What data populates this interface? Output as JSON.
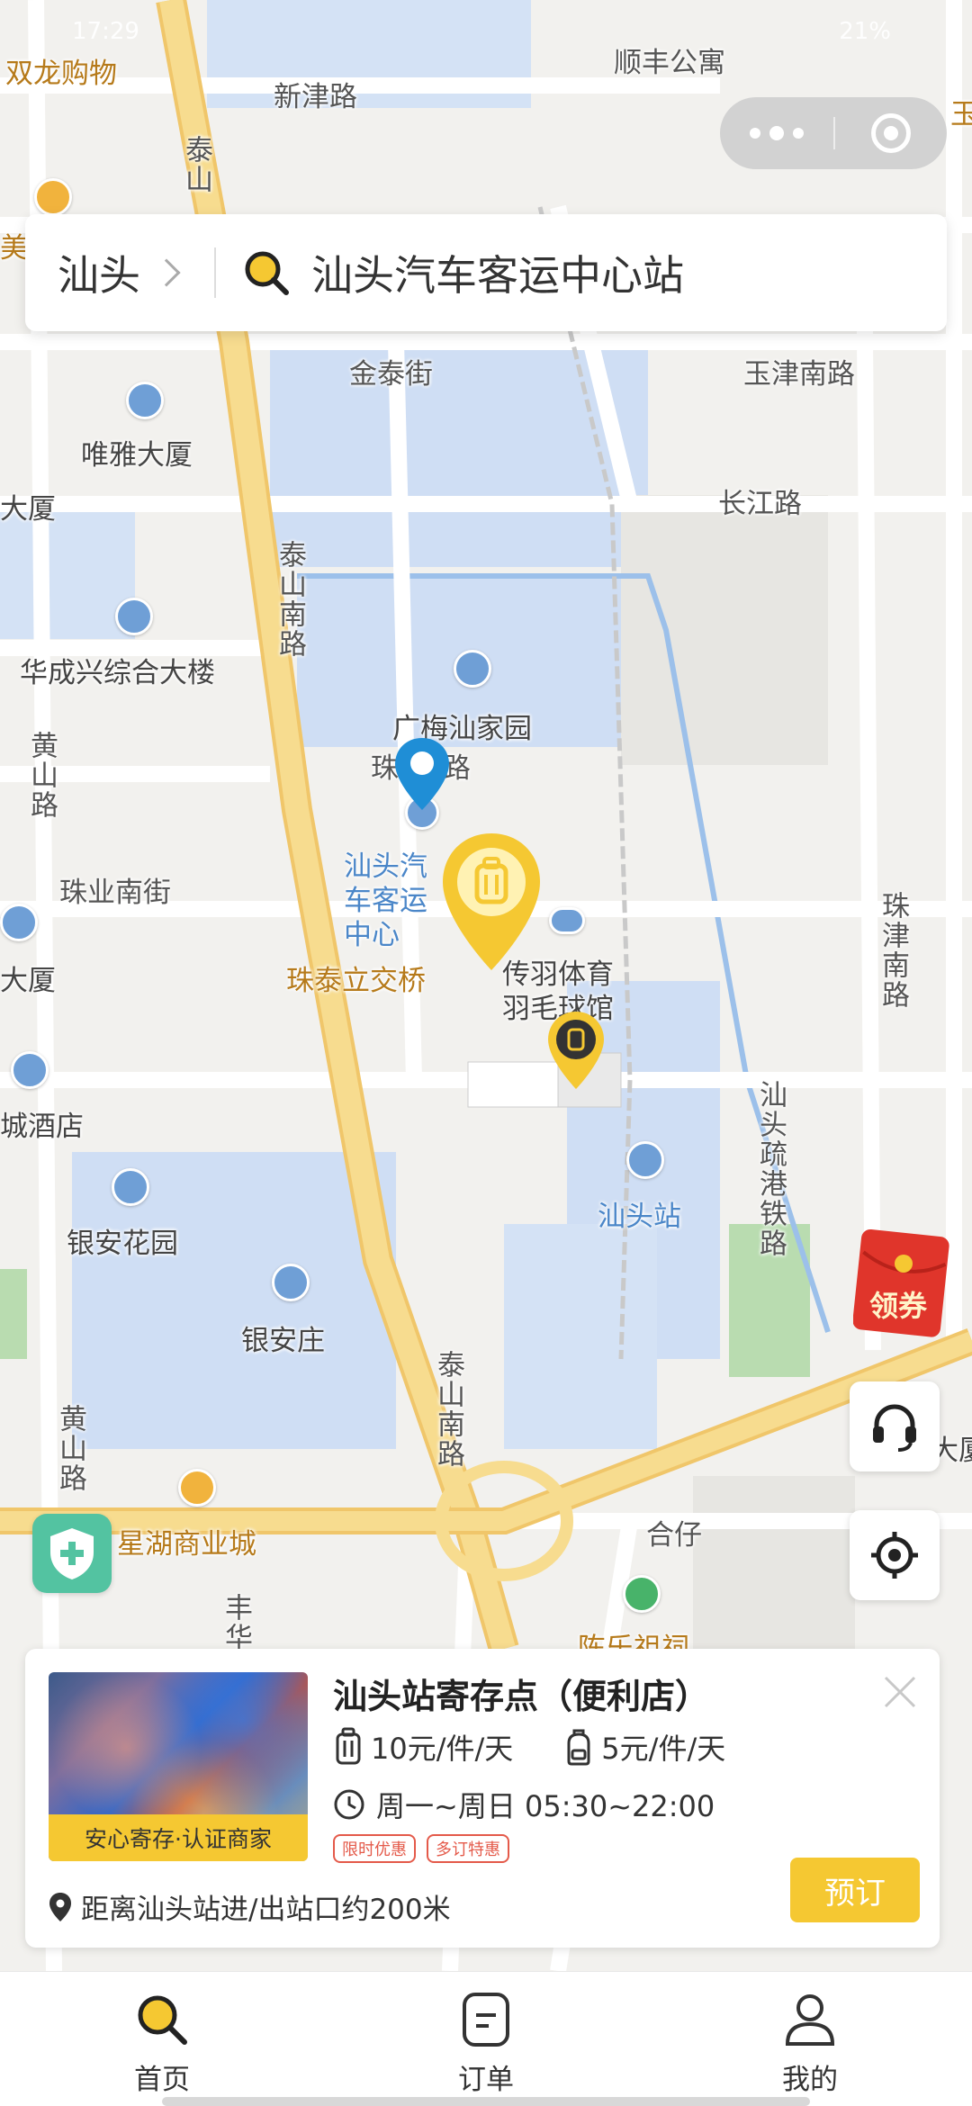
{
  "status_bar": {
    "time": "17:29",
    "battery": "21%"
  },
  "capsule": {
    "more_icon": "more-dots-icon",
    "close_icon": "close-ring-icon"
  },
  "search": {
    "city": "汕头",
    "station": "汕头汽车客运中心站"
  },
  "map_labels": {
    "shuanglong": "双龙购物",
    "shunfeng": "顺丰公寓",
    "xinjin": "新津路",
    "taishan_top": "泰山",
    "mei": "美",
    "yushan": "玉",
    "jintai": "金泰街",
    "yujin": "玉津南路",
    "weiya": "唯雅大厦",
    "dasha_left": "大厦",
    "changjiang": "长江路",
    "taishan_south": "泰山南路",
    "huachengxing": "华成兴综合大楼",
    "guangmei": "广梅汕家园",
    "huangshan1": "黄山路",
    "zhu_road": "珠",
    "zhu_road2": "路",
    "bus_station": "汕头汽车客运中心",
    "zhuye": "珠业南街",
    "dasha2": "大厦",
    "zhutai": "珠泰立交桥",
    "chuanyu": "传羽体育羽毛球馆",
    "zhujin": "珠津南路",
    "hotel": "城酒店",
    "shantou_station": "汕头站",
    "shugang": "汕头疏港铁路",
    "yinan_garden": "银安花园",
    "yinan_village": "银安庄",
    "taishan_south2": "泰山南路",
    "huangshan2": "黄山路",
    "xinghu": "星湖商业城",
    "hezai": "合仔",
    "chenle": "陈乐祖祠",
    "feng": "丰华",
    "dasha_right": "大厦"
  },
  "coupon": {
    "label": "领券"
  },
  "store": {
    "name": "汕头站寄存点（便利店）",
    "badge": "安心寄存·认证商家",
    "price_large": "10元/件/天",
    "price_small": "5元/件/天",
    "hours": "周一~周日 05:30~22:00",
    "tags": [
      "限时优惠",
      "多订特惠"
    ],
    "distance": "距离汕头站进/出站口约200米",
    "book": "预订"
  },
  "tabs": [
    {
      "label": "首页",
      "icon": "search-icon",
      "active": true
    },
    {
      "label": "订单",
      "icon": "order-icon",
      "active": false
    },
    {
      "label": "我的",
      "icon": "profile-icon",
      "active": false
    }
  ],
  "colors": {
    "accent": "#f5c832",
    "road_main": "#f7d77a",
    "water": "#c8d9f2"
  }
}
